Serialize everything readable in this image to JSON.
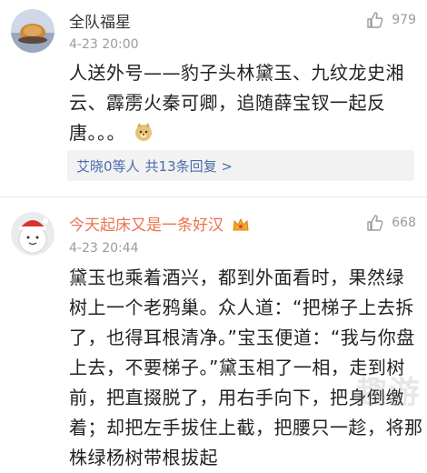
{
  "comments": [
    {
      "username": "全队福星",
      "timestamp": "4-23 20:00",
      "likes": "979",
      "lines": [
        "人送外号——豹子头林黛玉、九纹龙史湘",
        "云、霹雳火秦可卿，追随薛宝钗一起反",
        "唐。。。"
      ],
      "reply_users": "艾晓0等人",
      "reply_count": "共13条回复 >"
    },
    {
      "username": "今天起床又是一条好汉",
      "username_color": "#eb7350",
      "timestamp": "4-23 20:44",
      "likes": "668",
      "lines": [
        "黛玉也乘着酒兴，都到外面看时，果然绿",
        "树上一个老鸦巢。众人道：“把梯子上去拆",
        "了，也得耳根清净。”宝玉便道：“我与你盘",
        "上去，不要梯子。”黛玉相了一相，走到树",
        "前，把直掇脱了，用右手向下，把身倒缴",
        "着；却把左手拔住上截，把腰只一趁，将那",
        "株绿杨树带根拔起"
      ]
    }
  ],
  "watermark": "趣游"
}
